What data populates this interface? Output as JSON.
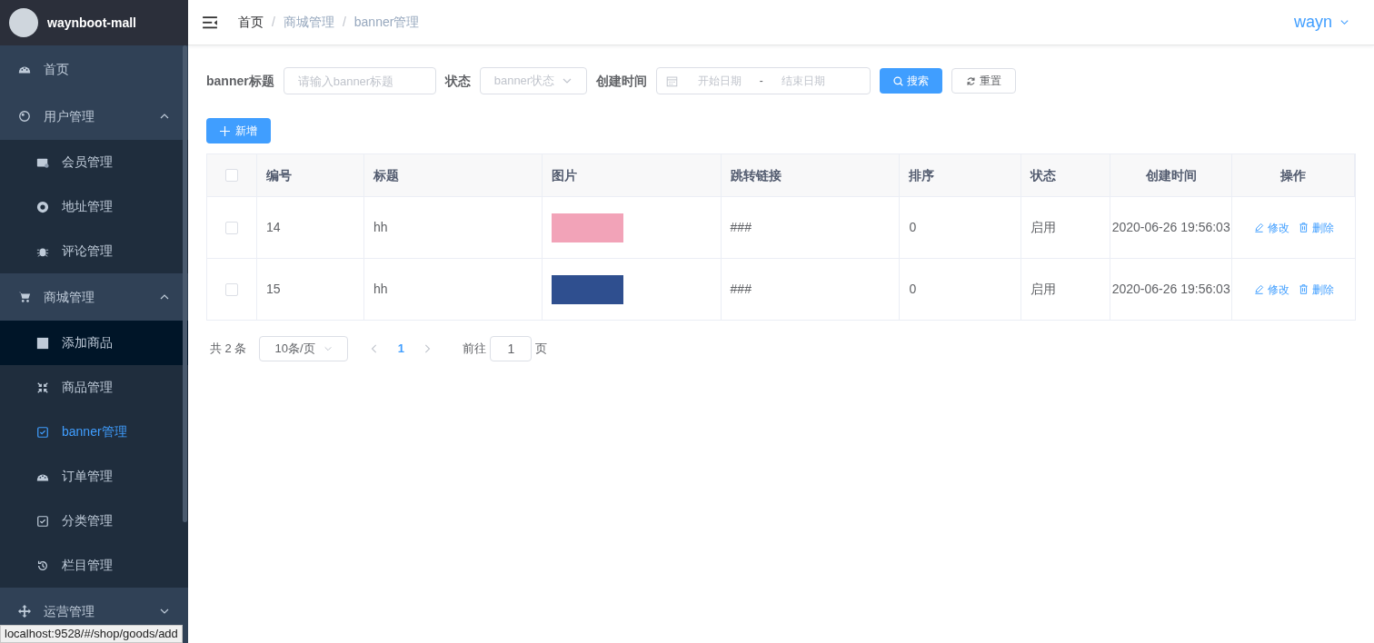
{
  "sidebar": {
    "title": "waynboot-mall",
    "items": [
      {
        "kind": "item",
        "label": "首页",
        "selected": false,
        "highlighted": false
      },
      {
        "kind": "group",
        "label": "用户管理",
        "expanded": true,
        "children": [
          {
            "label": "会员管理",
            "selected": false,
            "highlighted": false
          },
          {
            "label": "地址管理",
            "selected": false,
            "highlighted": false
          },
          {
            "label": "评论管理",
            "selected": false,
            "highlighted": false
          }
        ]
      },
      {
        "kind": "group",
        "label": "商城管理",
        "expanded": true,
        "children": [
          {
            "label": "添加商品",
            "selected": false,
            "highlighted": true
          },
          {
            "label": "商品管理",
            "selected": false,
            "highlighted": false
          },
          {
            "label": "banner管理",
            "selected": true,
            "highlighted": false
          },
          {
            "label": "订单管理",
            "selected": false,
            "highlighted": false
          },
          {
            "label": "分类管理",
            "selected": false,
            "highlighted": false
          },
          {
            "label": "栏目管理",
            "selected": false,
            "highlighted": false
          }
        ]
      },
      {
        "kind": "group",
        "label": "运营管理",
        "expanded": false
      }
    ]
  },
  "header": {
    "breadcrumb": [
      "首页",
      "商城管理",
      "banner管理"
    ],
    "breadcrumb_separator": "/",
    "user": "wayn"
  },
  "filters": {
    "title_label": "banner标题",
    "title_placeholder": "请输入banner标题",
    "status_label": "状态",
    "status_placeholder": "banner状态",
    "date_label": "创建时间",
    "start_placeholder": "开始日期",
    "separator": "-",
    "end_placeholder": "结束日期",
    "search_button": "搜索",
    "reset_button": "重置"
  },
  "add_button": "新增",
  "table": {
    "select_all": false,
    "columns": [
      "编号",
      "标题",
      "图片",
      "跳转链接",
      "排序",
      "状态",
      "创建时间",
      "操作"
    ],
    "rows": [
      {
        "checked": false,
        "id": "14",
        "title": "hh",
        "link": "###",
        "sort": "0",
        "status": "启用",
        "created": "2020-06-26 19:56:03",
        "edit": "修改",
        "delete": "删除"
      },
      {
        "checked": false,
        "id": "15",
        "title": "hh",
        "link": "###",
        "sort": "0",
        "status": "启用",
        "created": "2020-06-26 19:56:03",
        "edit": "修改",
        "delete": "删除"
      }
    ]
  },
  "pagination": {
    "total": "共 2 条",
    "page_size": "10条/页",
    "pages": [
      {
        "label": "1",
        "selected": true
      }
    ],
    "goto_label": "前往",
    "goto_value": "1",
    "goto_suffix": "页"
  },
  "status_bar": "localhost:9528/#/shop/goods/add"
}
